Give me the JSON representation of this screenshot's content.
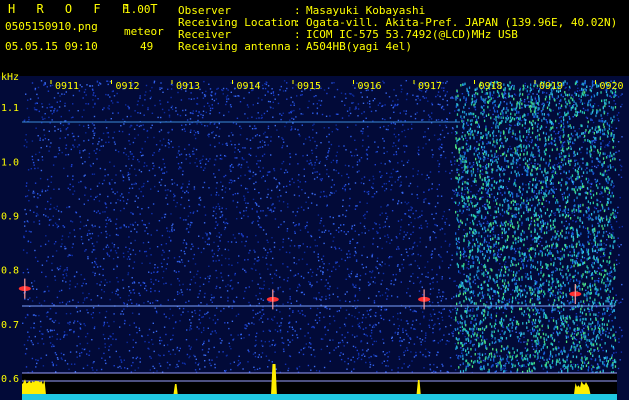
{
  "header": {
    "logo": "H R O F F T",
    "version": "1.00",
    "filename": "0505150910.png",
    "meteor_label": "meteor",
    "datetime": "05.05.15 09:10",
    "meteor_count": "49",
    "info": [
      {
        "key": "Observer",
        "value": "Masayuki Kobayashi"
      },
      {
        "key": "Receiving Location",
        "value": "Ogata-vill. Akita-Pref. JAPAN (139.96E, 40.02N)"
      },
      {
        "key": "Receiver",
        "value": "ICOM IC-575 53.7492(@LCD)MHz USB"
      },
      {
        "key": "Receiving antenna",
        "value": "A504HB(yagi 4el)"
      }
    ]
  },
  "plot": {
    "unit": "kHz",
    "time_labels": [
      "0911",
      "0912",
      "0913",
      "0914",
      "0915",
      "0916",
      "0917",
      "0918",
      "0919",
      "0920"
    ],
    "freq_labels": [
      "1.1",
      "1.0",
      "0.9",
      "0.8",
      "0.7",
      "0.6"
    ],
    "colors": {
      "label": "#ffff00",
      "background": "#020a38",
      "noise": "#1e3cc8",
      "meteor": "#ff3030",
      "trace": "#ffee00"
    },
    "freq_range_khz": [
      0.6,
      1.15
    ],
    "meteor_echoes": [
      {
        "time": "0910.5",
        "freq_khz": 0.765
      },
      {
        "time": "0914.6",
        "freq_khz": 0.745
      },
      {
        "time": "0917.1",
        "freq_khz": 0.745
      },
      {
        "time": "0919.6",
        "freq_khz": 0.755
      }
    ]
  }
}
